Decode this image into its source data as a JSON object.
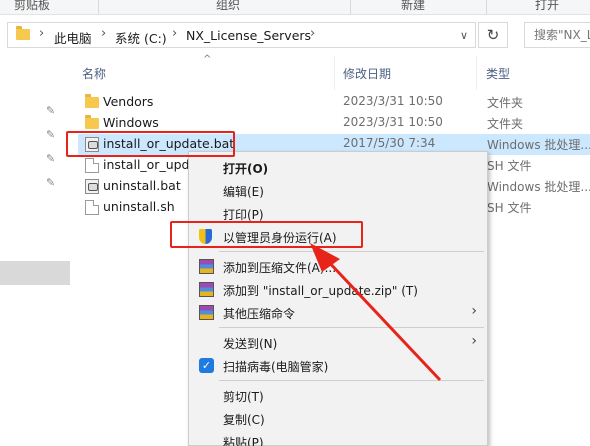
{
  "ribbon": {
    "labels": [
      "剪贴板",
      "组织",
      "新建",
      "打开"
    ]
  },
  "address": {
    "breadcrumbs": [
      "此电脑",
      "系统 (C:)",
      "NX_License_Servers"
    ],
    "separators": [
      "›",
      "›",
      "›",
      "›"
    ],
    "refresh_icon": "↻",
    "dropdown_icon": "∨",
    "search_placeholder": "搜索\"NX_Li"
  },
  "columns": {
    "name": "名称",
    "date": "修改日期",
    "type": "类型",
    "sort_icon": "^"
  },
  "files": [
    {
      "name": "Vendors",
      "date": "2023/3/31 10:50",
      "type": "文件夹",
      "icon": "folder-icon"
    },
    {
      "name": "Windows",
      "date": "2023/3/31 10:50",
      "type": "文件夹",
      "icon": "folder-icon"
    },
    {
      "name": "install_or_update.bat",
      "date": "2017/5/30 7:34",
      "type": "Windows 批处理...",
      "icon": "bat-icon",
      "selected": true
    },
    {
      "name": "install_or_upda",
      "date": "",
      "type": "SH 文件",
      "icon": "sh-icon"
    },
    {
      "name": "uninstall.bat",
      "date": "",
      "type": "Windows 批处理...",
      "icon": "bat-icon"
    },
    {
      "name": "uninstall.sh",
      "date": "",
      "type": "SH 文件",
      "icon": "sh-icon"
    }
  ],
  "context_menu": {
    "open": "打开(O)",
    "edit": "编辑(E)",
    "print": "打印(P)",
    "run_as_admin": "以管理员身份运行(A)",
    "add_to_archive": "添加到压缩文件(A)...",
    "add_to_zip": "添加到 \"install_or_update.zip\" (T)",
    "other_compress": "其他压缩命令",
    "send_to": "发送到(N)",
    "scan_virus": "扫描病毒(电脑管家)",
    "cut": "剪切(T)",
    "copy": "复制(C)",
    "paste": "粘贴(P)",
    "submenu_arrow": "›",
    "guard_glyph": "✓"
  },
  "annotation_color": "#e8241a",
  "selection_color": "#cce8ff"
}
